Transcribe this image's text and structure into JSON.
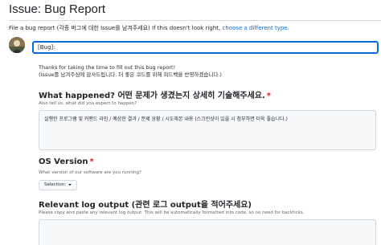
{
  "header": {
    "title": "Issue: Bug Report",
    "subtitle_prefix": "File a bug report (각종 버그에 대한 Issue를 남겨주세요) If this doesn't look right, ",
    "subtitle_link": "choose a different type."
  },
  "title_input": {
    "value": "[Bug]: "
  },
  "intro": {
    "line1": "Thanks for taking the time to fill out this bug report!",
    "line2": "(Issue를 남겨주심에 감사드립니다. 더 좋은 코드를 위해 피드백을 반영하겠습니다.)"
  },
  "what_happened": {
    "label": "What happened? 어떤 문제가 생겼는지 상세히 기술해주세요.",
    "required_mark": "*",
    "description": "Also tell us, what did you expect to happen?",
    "value": "실행한 프로그램 및 커맨드 라인 / 예상한 결과 / 문제 상황 / 시도해본 내용 (스크린샷이 있을 시 첨부하면 더욱 좋습니다.)"
  },
  "os_version": {
    "label": "OS Version",
    "required_mark": "*",
    "description": "What version of our software are you running?",
    "select_label": "Selection:"
  },
  "log_output": {
    "label": "Relevant log output (관련 로그 output을 적어주세요)",
    "description": "Please copy and paste any relevant log output. This will be automatically formatted into code, so no need for backticks."
  },
  "colors": {
    "link": "#0969da",
    "required": "#cf222e",
    "focus_border": "#0969da"
  }
}
